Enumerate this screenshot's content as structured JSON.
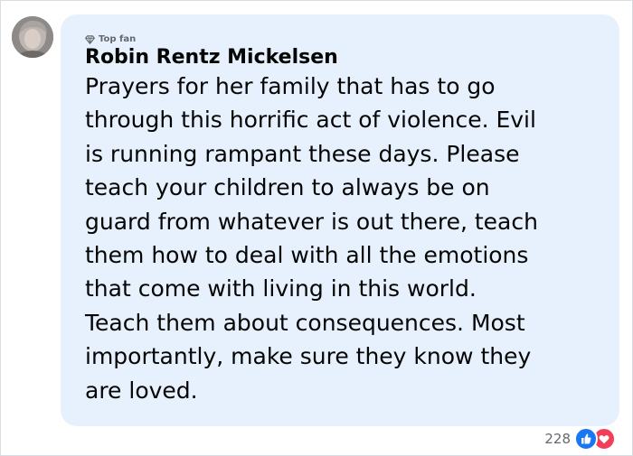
{
  "comment": {
    "badge_label": "Top fan",
    "author_name": "Robin Rentz Mickelsen",
    "body_lines": [
      "Prayers for her family that has to go",
      "through this horrific act of violence. Evil",
      "is running rampant these days. Please",
      "teach your children to always be on",
      "guard from whatever is out there, teach",
      "them how to deal with all the emotions",
      "that come with living in this world.",
      "Teach them about consequences. Most",
      "importantly, make sure they know they",
      "are loved."
    ],
    "reaction_count": "228",
    "reactions": [
      "like-icon",
      "love-icon"
    ]
  },
  "colors": {
    "bubble": "#e6f1fd",
    "like": "#1877f2",
    "love": "#f33e58",
    "meta_text": "#65686c"
  }
}
